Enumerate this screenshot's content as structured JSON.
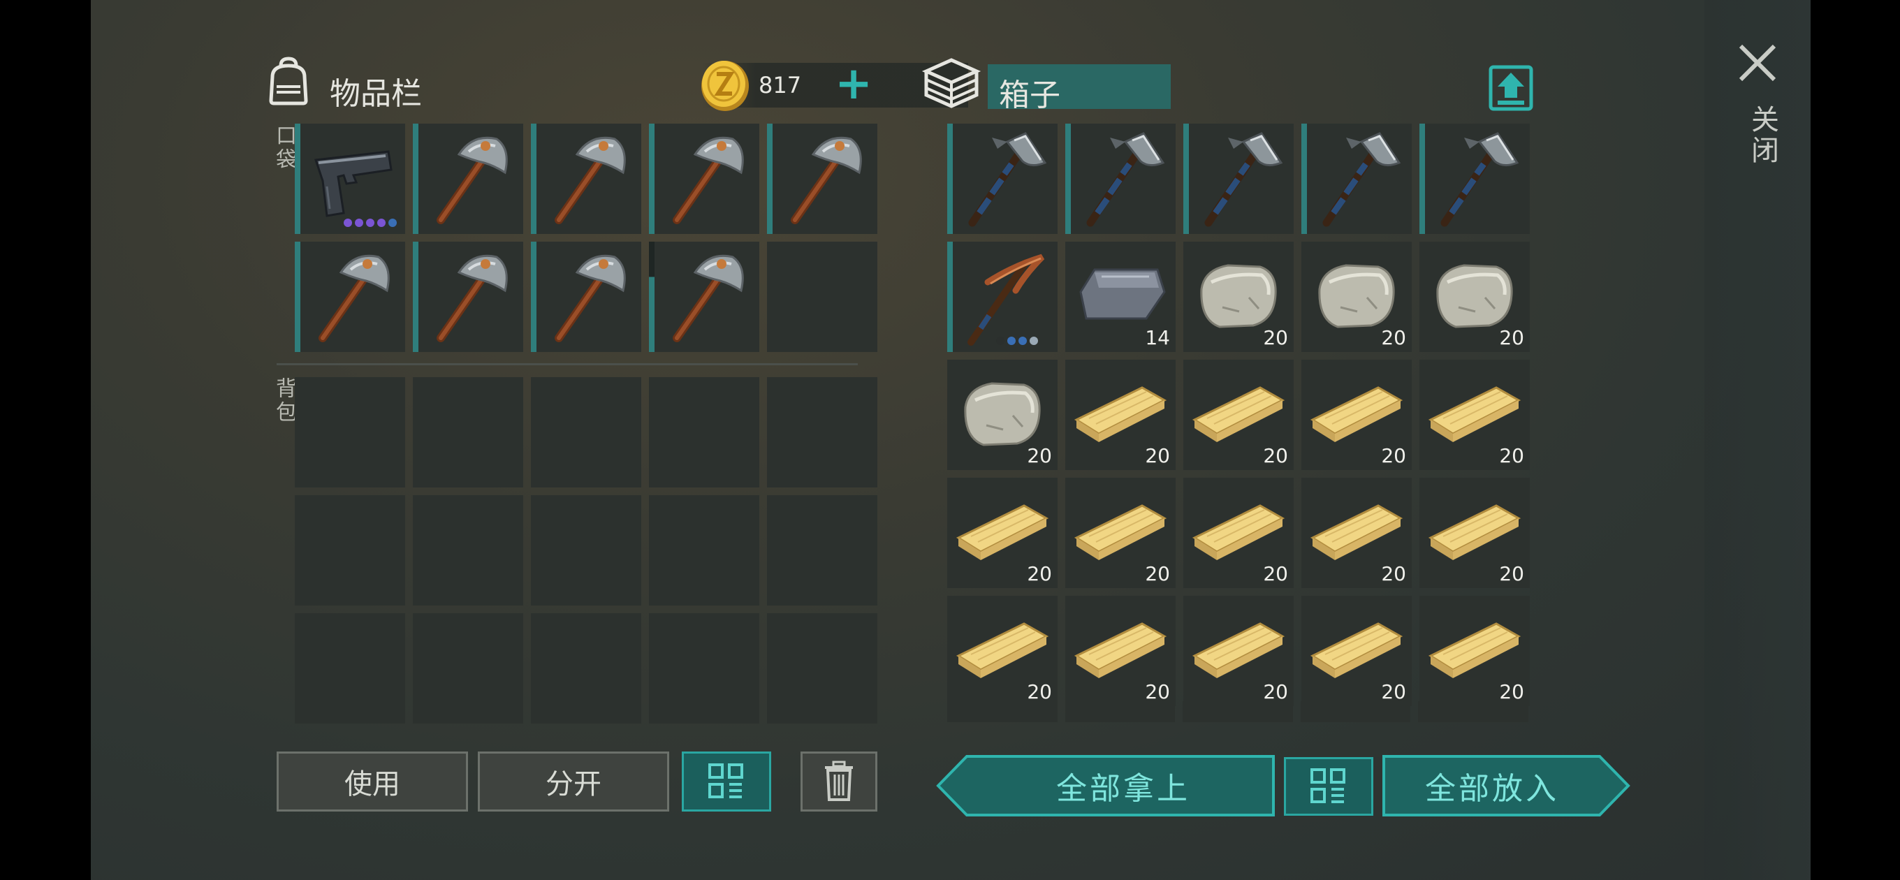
{
  "inventory": {
    "title": "物品栏",
    "pockets_label": "口袋",
    "backpack_label": "背包",
    "coins": "817",
    "pockets": [
      {
        "icon": "pistol",
        "dots": [
          "#7b55d4",
          "#7b55d4",
          "#7b55d4",
          "#7b55d4",
          "#3a6fb6"
        ]
      },
      {
        "icon": "stone-hammer"
      },
      {
        "icon": "stone-hammer"
      },
      {
        "icon": "stone-hammer"
      },
      {
        "icon": "stone-hammer"
      },
      {
        "icon": "stone-hammer"
      },
      {
        "icon": "stone-hammer"
      },
      {
        "icon": "stone-hammer"
      },
      {
        "icon": "stone-hammer"
      },
      {
        "icon": ""
      }
    ]
  },
  "box": {
    "title": "箱子",
    "slots": [
      {
        "icon": "iron-axe",
        "count": ""
      },
      {
        "icon": "iron-axe",
        "count": ""
      },
      {
        "icon": "iron-axe",
        "count": ""
      },
      {
        "icon": "iron-axe",
        "count": ""
      },
      {
        "icon": "iron-axe",
        "count": ""
      },
      {
        "icon": "copper-pickaxe",
        "count": "",
        "dots": [
          "#2b2f2d",
          "#3a6fb6",
          "#3a6fb6",
          "#9aa9b5"
        ]
      },
      {
        "icon": "iron-ingot",
        "count": "14"
      },
      {
        "icon": "stone",
        "count": "20"
      },
      {
        "icon": "stone",
        "count": "20"
      },
      {
        "icon": "stone",
        "count": "20"
      },
      {
        "icon": "stone",
        "count": "20"
      },
      {
        "icon": "plank",
        "count": "20"
      },
      {
        "icon": "plank",
        "count": "20"
      },
      {
        "icon": "plank",
        "count": "20"
      },
      {
        "icon": "plank",
        "count": "20"
      },
      {
        "icon": "plank",
        "count": "20"
      },
      {
        "icon": "plank",
        "count": "20"
      },
      {
        "icon": "plank",
        "count": "20"
      },
      {
        "icon": "plank",
        "count": "20"
      },
      {
        "icon": "plank",
        "count": "20"
      },
      {
        "icon": "plank",
        "count": "20"
      },
      {
        "icon": "plank",
        "count": "20"
      },
      {
        "icon": "plank",
        "count": "20"
      },
      {
        "icon": "plank",
        "count": "20"
      },
      {
        "icon": "plank",
        "count": "20"
      }
    ]
  },
  "buttons": {
    "use": "使用",
    "split": "分开",
    "take_all": "全部拿上",
    "put_all": "全部放入",
    "close": "关闭"
  },
  "colors": {
    "accent": "#2aa7a2",
    "slot": "#2c312e",
    "durability": "#2f7e7c"
  }
}
